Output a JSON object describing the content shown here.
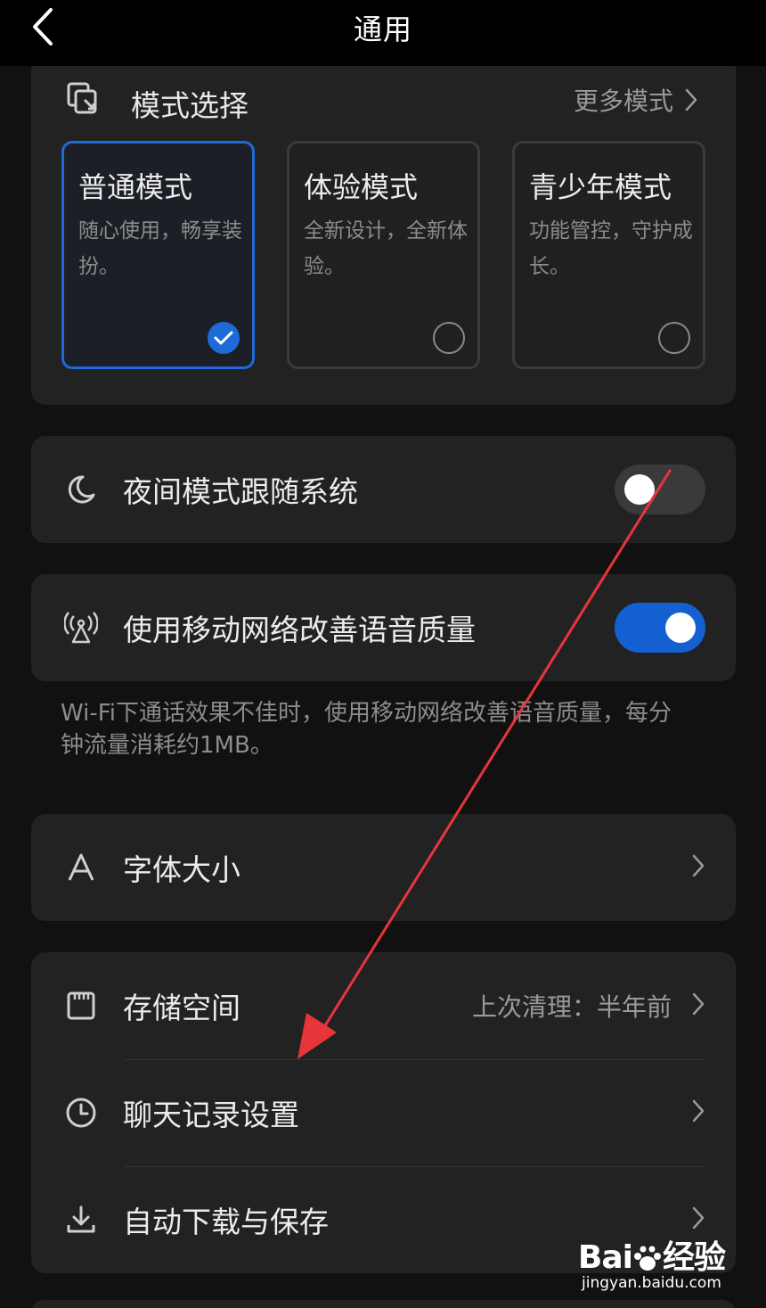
{
  "header": {
    "title": "通用"
  },
  "mode_section": {
    "title": "模式选择",
    "more_label": "更多模式",
    "modes": [
      {
        "name": "普通模式",
        "desc": "随心使用，畅享装扮。",
        "selected": true
      },
      {
        "name": "体验模式",
        "desc": "全新设计，全新体验。",
        "selected": false
      },
      {
        "name": "青少年模式",
        "desc": "功能管控，守护成长。",
        "selected": false
      }
    ]
  },
  "night_mode": {
    "label": "夜间模式跟随系统",
    "enabled": false
  },
  "mobile_voice": {
    "label": "使用移动网络改善语音质量",
    "enabled": true,
    "note": "Wi-Fi下通话效果不佳时，使用移动网络改善语音质量，每分钟流量消耗约1MB。"
  },
  "font_size": {
    "label": "字体大小"
  },
  "storage_group": {
    "items": [
      {
        "label": "存储空间",
        "value": "上次清理：半年前",
        "icon": "storage-icon"
      },
      {
        "label": "聊天记录设置",
        "value": "",
        "icon": "clock-icon"
      },
      {
        "label": "自动下载与保存",
        "value": "",
        "icon": "download-icon"
      }
    ]
  },
  "annotation": {
    "color": "#e8353a"
  },
  "watermark": {
    "logo": "Bai经验",
    "url": "jingyan.baidu.com"
  },
  "colors": {
    "accent": "#1e6ad8",
    "card": "#222222",
    "background": "#111111"
  }
}
